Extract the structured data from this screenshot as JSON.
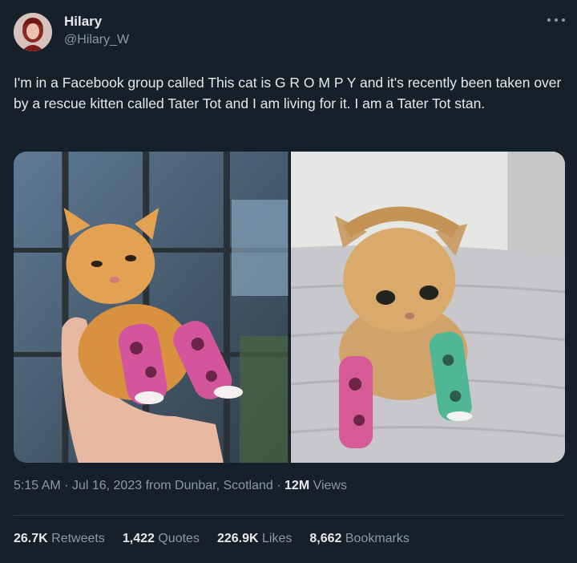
{
  "author": {
    "name": "Hilary",
    "handle": "@Hilary_W"
  },
  "tweet": {
    "text": "I'm in a Facebook group called This cat is G R O M P Y and it's recently been taken over by a rescue kitten called Tater Tot and I am living for it. I am a Tater Tot stan."
  },
  "meta": {
    "time": "5:15 AM",
    "date": "Jul 16, 2023",
    "location": "from Dunbar, Scotland",
    "views_count": "12M",
    "views_label": "Views"
  },
  "stats": {
    "retweets": {
      "count": "26.7K",
      "label": "Retweets"
    },
    "quotes": {
      "count": "1,422",
      "label": "Quotes"
    },
    "likes": {
      "count": "226.9K",
      "label": "Likes"
    },
    "bookmarks": {
      "count": "8,662",
      "label": "Bookmarks"
    }
  },
  "colors": {
    "background": "#15202b",
    "primary_text": "#e7e9ea",
    "secondary_text": "#8b98a5",
    "divider": "#2f3b47"
  }
}
